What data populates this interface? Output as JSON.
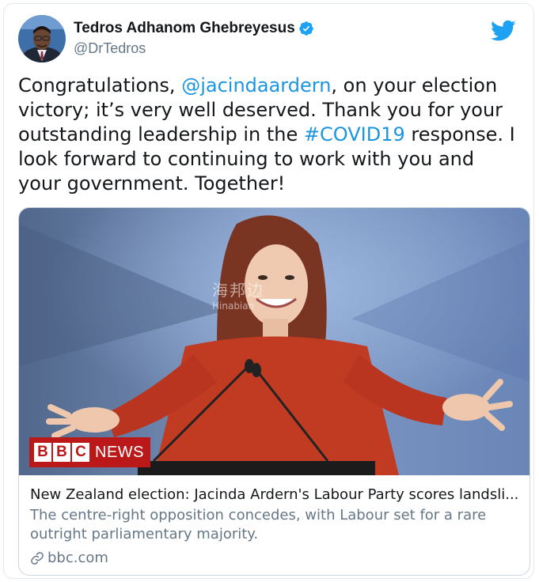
{
  "author": {
    "display_name": "Tedros Adhanom Ghebreyesus",
    "handle": "@DrTedros",
    "verified": true,
    "avatar_icon": "avatar-photo"
  },
  "brand_icon": "twitter-bird-icon",
  "colors": {
    "link": "#1b95e0",
    "verified": "#1da1f2",
    "twitter": "#1da1f2",
    "secondary_text": "#657786",
    "bbc_red": "#bb1919"
  },
  "tweet": {
    "segments": [
      {
        "text": "Congratulations, ",
        "type": "text"
      },
      {
        "text": "@jacindaardern",
        "type": "mention"
      },
      {
        "text": ", on your election victory; it’s very well deserved. Thank you for your outstanding leadership in the ",
        "type": "text"
      },
      {
        "text": "#COVID19",
        "type": "hashtag"
      },
      {
        "text": " response. I look forward to continuing to work with you and your government. Together!",
        "type": "text"
      }
    ]
  },
  "link_card": {
    "badge_letters": [
      "B",
      "B",
      "C"
    ],
    "badge_label": "NEWS",
    "watermark_cn": "海邦边",
    "watermark_en": "Hinabian",
    "title": "New Zealand election: Jacinda Ardern's Labour Party scores landsli...",
    "description": "The centre-right opposition concedes, with Labour set for a rare outright parliamentary majority.",
    "domain": "bbc.com",
    "domain_icon": "link-icon"
  }
}
